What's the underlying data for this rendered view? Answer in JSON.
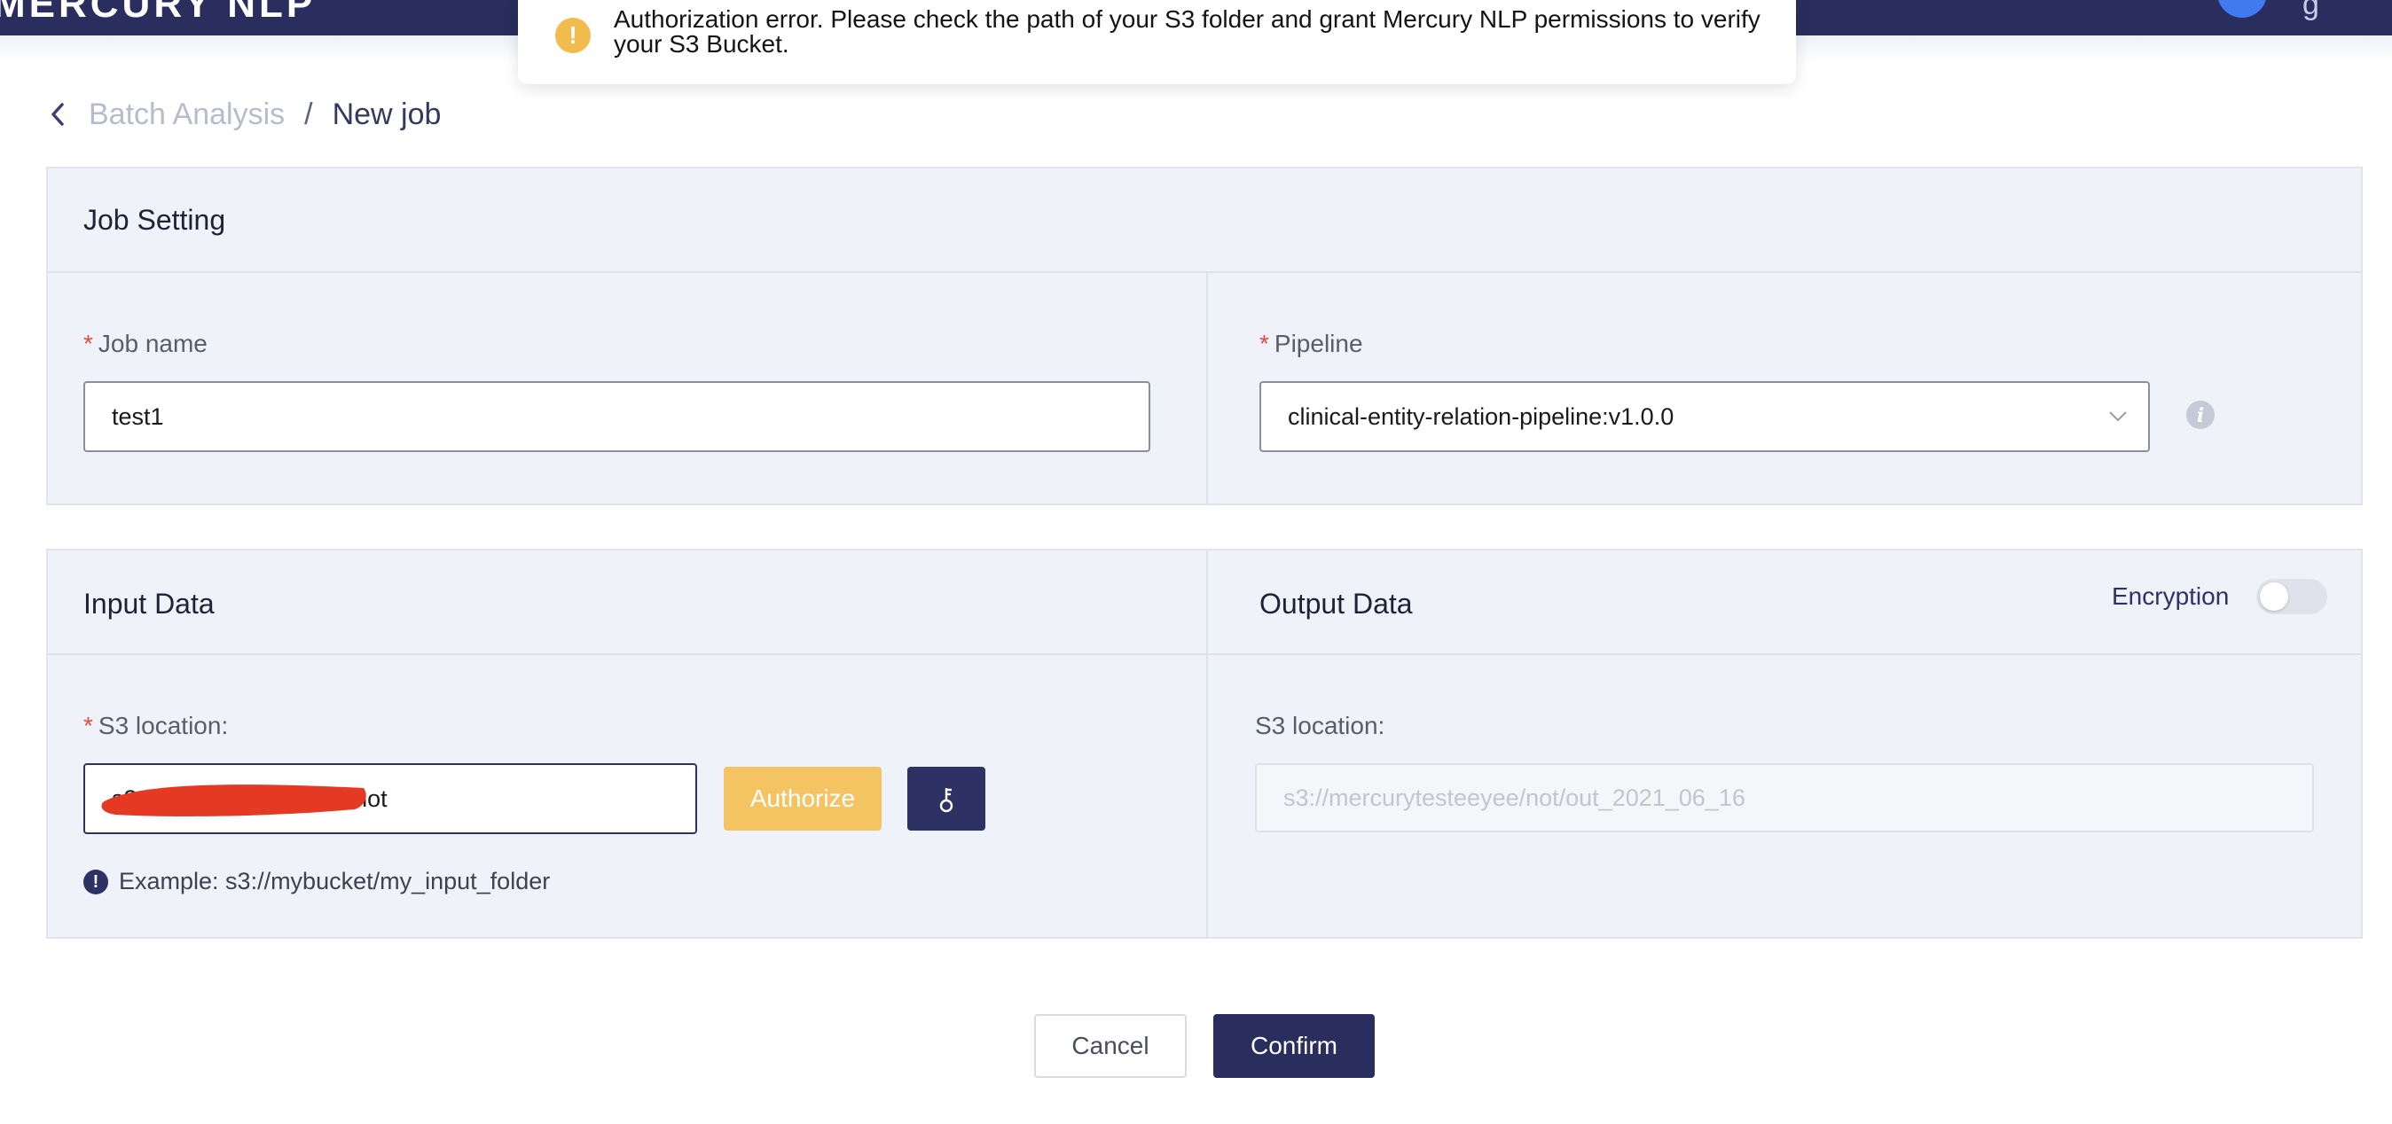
{
  "header": {
    "brand": "MERCURY NLP",
    "user_text": "g"
  },
  "toast": {
    "message": "Authorization error. Please check the path of your S3 folder and grant Mercury NLP permissions to verify your S3 Bucket.",
    "icon": "warning-icon"
  },
  "breadcrumb": {
    "parent": "Batch Analysis",
    "separator": "/",
    "current": "New job"
  },
  "job_setting": {
    "title": "Job Setting",
    "job_name_label": "Job name",
    "job_name_value": "test1",
    "pipeline_label": "Pipeline",
    "pipeline_value": "clinical-entity-relation-pipeline:v1.0.0"
  },
  "input_data": {
    "title": "Input Data",
    "s3_label": "S3 location:",
    "s3_value": "s3://mercurytesteeyee/not",
    "authorize_label": "Authorize",
    "key_icon": "key-icon",
    "hint": "Example: s3://mybucket/my_input_folder"
  },
  "output_data": {
    "title": "Output Data",
    "encryption_label": "Encryption",
    "encryption_enabled": false,
    "s3_label": "S3 location:",
    "s3_placeholder": "s3://mercurytesteeyee/not/out_2021_06_16"
  },
  "actions": {
    "cancel": "Cancel",
    "confirm": "Confirm"
  },
  "required_marker": "*",
  "colors": {
    "navy": "#2a2e5e",
    "accent_yellow": "#f3c461",
    "required_red": "#e34b3f",
    "panel_bg": "#eff2f9"
  }
}
